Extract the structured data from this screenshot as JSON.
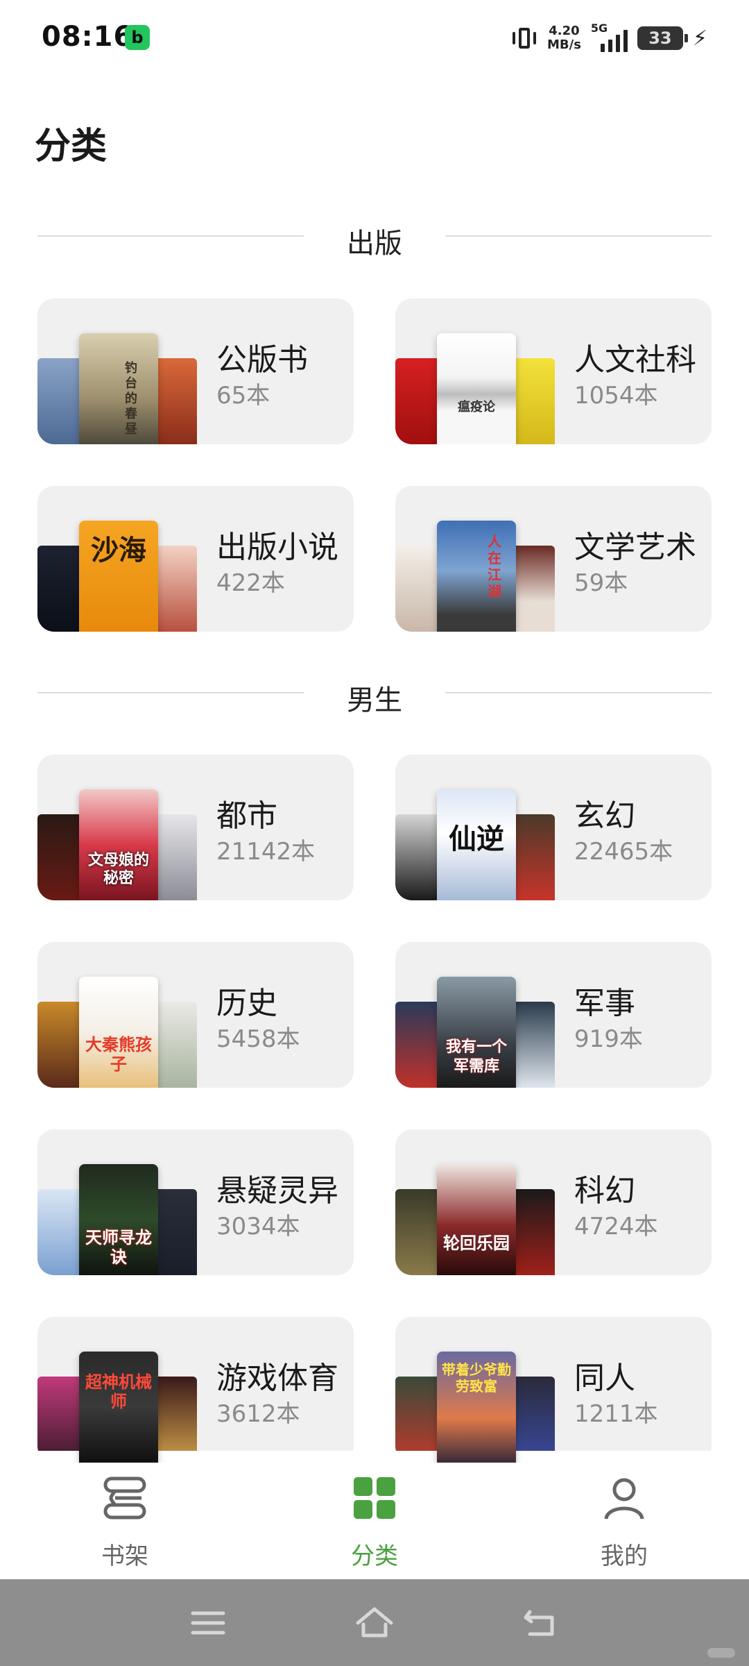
{
  "status_bar": {
    "time": "08:16",
    "app_badge": "b",
    "net_speed_value": "4.20",
    "net_speed_unit": "MB/s",
    "network_type": "5G",
    "battery": "33"
  },
  "page": {
    "title": "分类"
  },
  "sections": [
    {
      "label": "出版"
    },
    {
      "label": "男生"
    }
  ],
  "categories": [
    {
      "title": "公版书",
      "count": "65本"
    },
    {
      "title": "人文社科",
      "count": "1054本"
    },
    {
      "title": "出版小说",
      "count": "422本"
    },
    {
      "title": "文学艺术",
      "count": "59本"
    },
    {
      "title": "都市",
      "count": "21142本"
    },
    {
      "title": "玄幻",
      "count": "22465本"
    },
    {
      "title": "历史",
      "count": "5458本"
    },
    {
      "title": "军事",
      "count": "919本"
    },
    {
      "title": "悬疑灵异",
      "count": "3034本"
    },
    {
      "title": "科幻",
      "count": "4724本"
    },
    {
      "title": "游戏体育",
      "count": "3612本"
    },
    {
      "title": "同人",
      "count": "1211本"
    }
  ],
  "cover_text": {
    "c1": "钓台的春昼",
    "c2": "瘟疫论",
    "c3": "沙海",
    "c4": "人在江湖",
    "c5": "文母娘的秘密",
    "c6": "仙逆",
    "c7": "大秦熊孩子",
    "c8": "我有一个军需库",
    "c9": "天师寻龙诀",
    "c10": "轮回乐园",
    "c11": "超神机械师",
    "c12": "带着少爷勤劳致富"
  },
  "tabs": [
    {
      "label": "书架",
      "icon": "bookshelf-icon",
      "active": false
    },
    {
      "label": "分类",
      "icon": "category-grid-icon",
      "active": true
    },
    {
      "label": "我的",
      "icon": "profile-icon",
      "active": false
    }
  ],
  "colors": {
    "accent": "#4aa140",
    "card_bg": "#f0f0f0",
    "count_text": "#8a8a8a",
    "nav_bar": "#8e8e8e"
  }
}
